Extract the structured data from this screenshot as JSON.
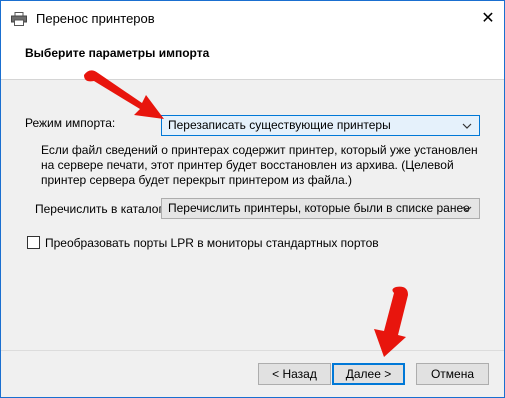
{
  "window": {
    "title": "Перенос принтеров",
    "close_glyph": "✕"
  },
  "header": {
    "title": "Выберите параметры импорта"
  },
  "import_mode": {
    "label": "Режим импорта:",
    "value": "Перезаписать существующие принтеры"
  },
  "description": "Если файл сведений о принтерах содержит принтер, который уже установлен на сервере печати, этот принтер будет восстановлен из архива.  (Целевой принтер сервера будет перекрыт принтером из файла.)",
  "list_in_directory": {
    "label": "Перечислить в каталоге:",
    "value": "Перечислить принтеры, которые были в списке ранее"
  },
  "lpr_checkbox": {
    "label": "Преобразовать порты LPR в мониторы стандартных портов",
    "checked": false
  },
  "buttons": {
    "back": "< Назад",
    "next": "Далее >",
    "cancel": "Отмена"
  },
  "colors": {
    "accent": "#0078d7",
    "arrow": "#e8150d"
  },
  "icons": [
    "printer-icon",
    "close-icon",
    "chevron-down-icon",
    "red-arrow-annotation"
  ]
}
